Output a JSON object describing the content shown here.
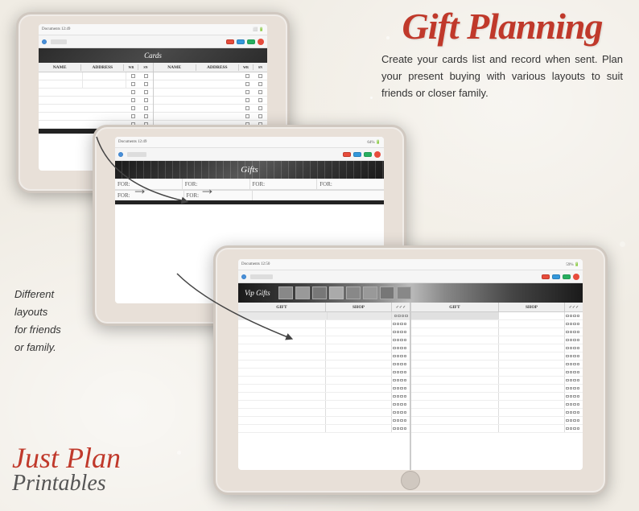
{
  "title": {
    "line1": "Gift Planning",
    "description": "Create your cards list and record when sent.  Plan your present buying with various layouts to suit friends or closer  family."
  },
  "brand": {
    "line1": "Just Plan",
    "line2": "Printables"
  },
  "side_text": {
    "line1": "Different",
    "line2": "layouts",
    "line3": "for friends",
    "line4": "or family."
  },
  "tablet1": {
    "label": "cards-tablet",
    "screen_label": "Cards",
    "col1": "NAME",
    "col2": "ADDRESS",
    "col3": "WRITTEN",
    "col4": "SENT"
  },
  "tablet2": {
    "label": "gifts-tablet",
    "screen_label": "Gifts",
    "for_label": "FOR:",
    "arrow": "→"
  },
  "tablet3": {
    "label": "vip-gifts-tablet",
    "screen_label": "Vip Gifts",
    "col_gift": "GIFT",
    "col_shop": "SHOP"
  }
}
